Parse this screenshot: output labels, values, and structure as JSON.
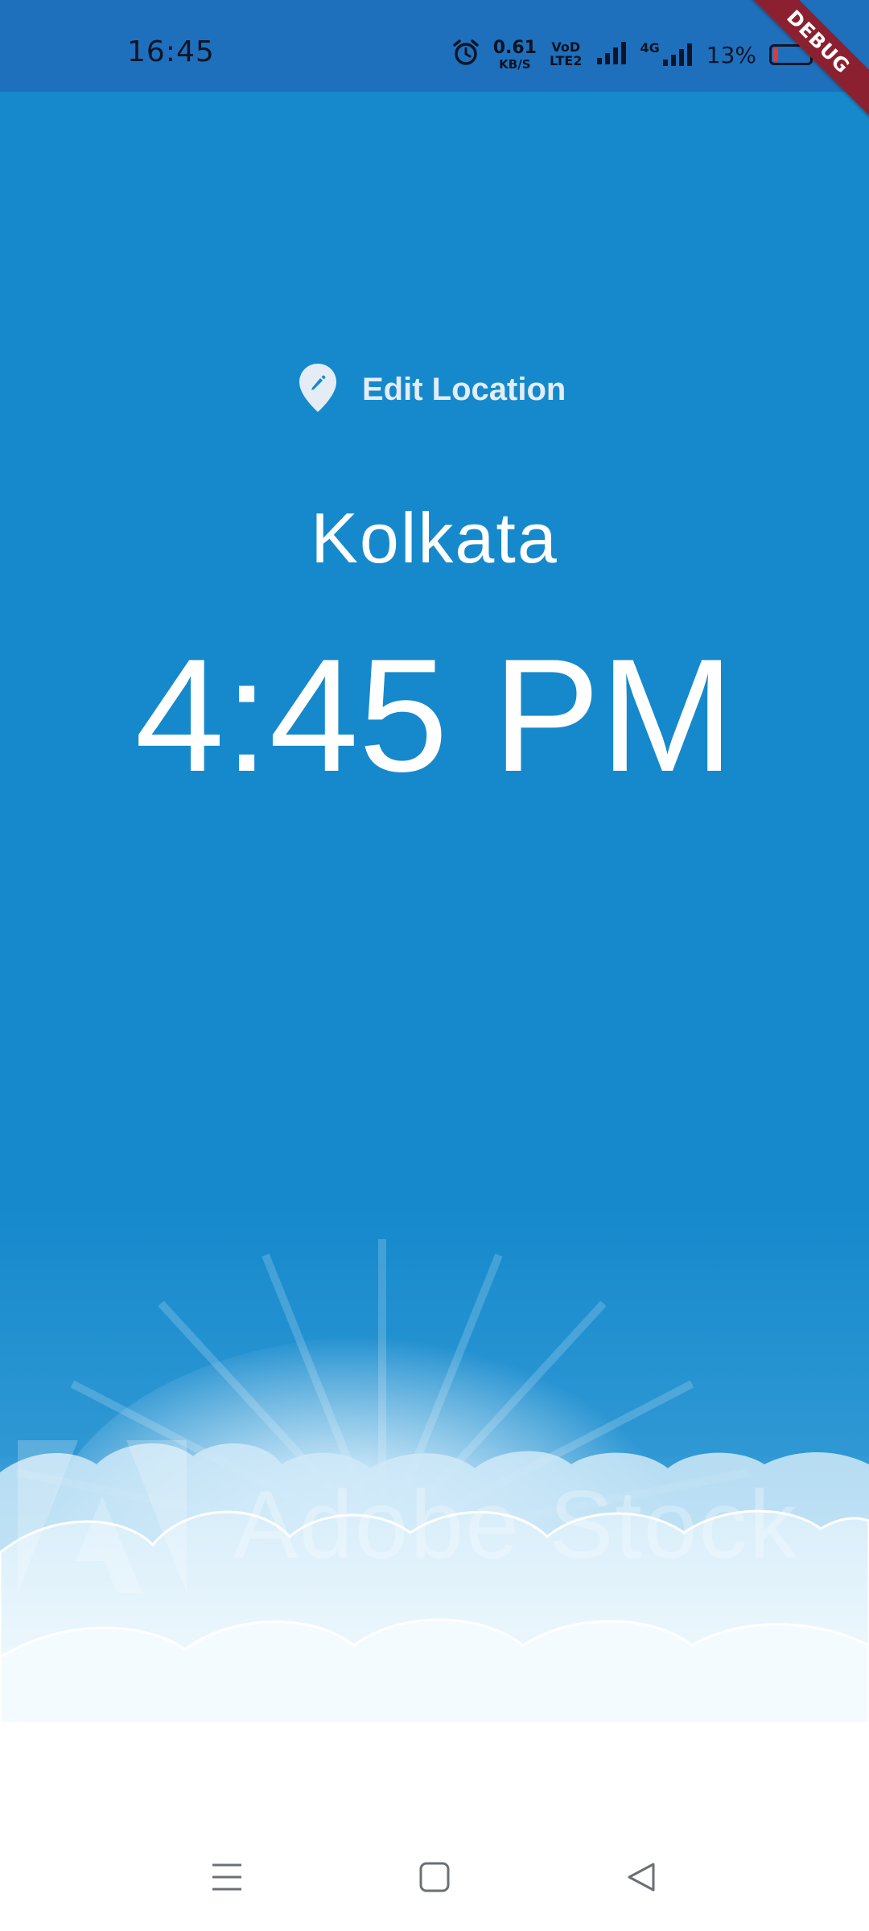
{
  "status_bar": {
    "time": "16:45",
    "net_speed_value": "0.61",
    "net_speed_unit": "KB/S",
    "volte_line1": "VoD",
    "volte_line2": "LTE2",
    "network_type": "4G",
    "battery_percent": "13%",
    "battery_level": 0.13,
    "battery_color": "#e53935",
    "icons": [
      "alarm-icon",
      "signal-icon",
      "signal-4g-icon",
      "battery-icon"
    ]
  },
  "debug_banner": {
    "label": "DEBUG",
    "color": "#8b2130"
  },
  "location_screen": {
    "edit_location_label": "Edit Location",
    "edit_location_icon": "edit-location-icon",
    "city": "Kolkata",
    "time": "4:45 PM",
    "background_color": "#1589cc"
  },
  "background_image": {
    "watermark_text": "Adobe Stock",
    "watermark_logo": "adobe-logo"
  },
  "nav_bar": {
    "buttons": [
      "menu-icon",
      "home-icon",
      "back-icon"
    ]
  }
}
